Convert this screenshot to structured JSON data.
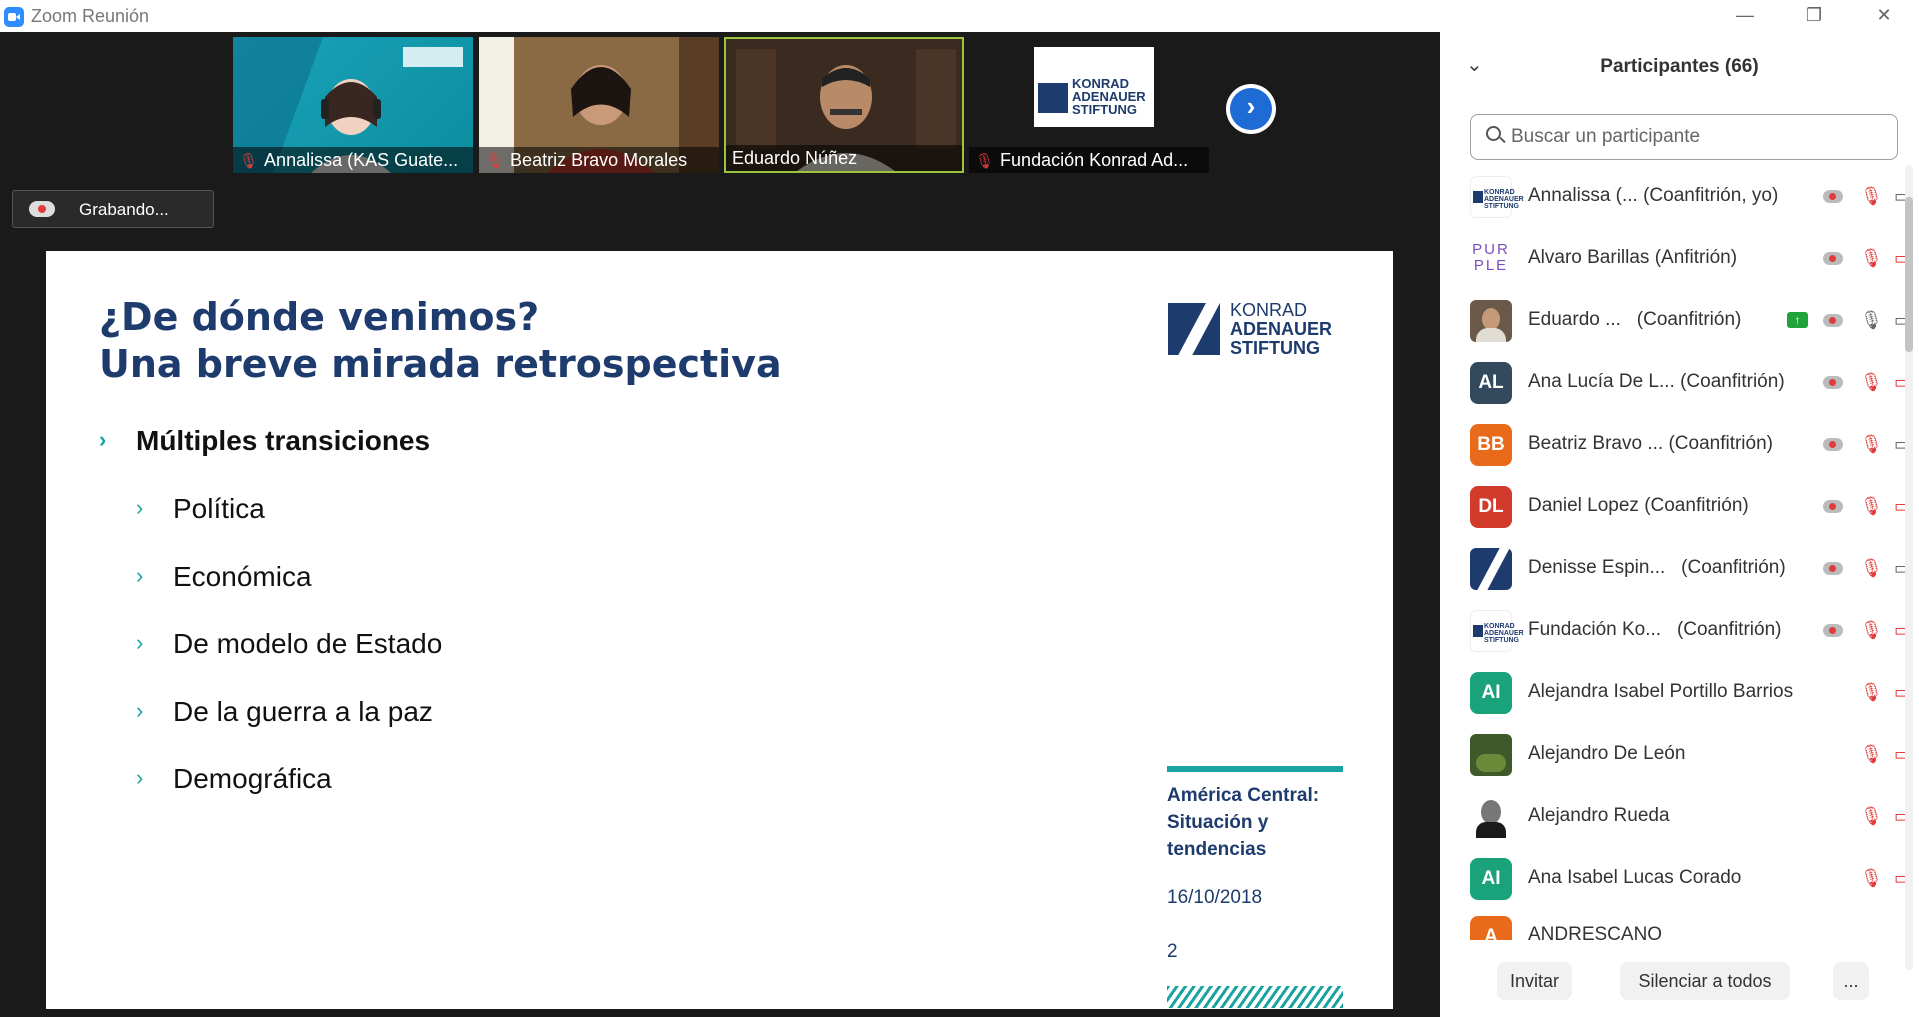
{
  "window": {
    "title": "Zoom Reunión",
    "minimize": "—",
    "restore": "❐",
    "close": "✕"
  },
  "recording": {
    "label": "Grabando..."
  },
  "thumbnails": [
    {
      "name": "Annalissa (KAS Guate...",
      "muted": true
    },
    {
      "name": "Beatriz Bravo Morales",
      "muted": true
    },
    {
      "name": "Eduardo Núñez",
      "muted": false
    },
    {
      "name": "Fundación Konrad Ad...",
      "muted": true
    }
  ],
  "thumb_logo_text": [
    "KONRAD",
    "ADENAUER",
    "STIFTUNG"
  ],
  "next_icon": "›",
  "slide": {
    "title_line1": "¿De dónde venimos?",
    "title_line2": "Una breve mirada retrospectiva",
    "bullet_main": "Múltiples transiciones",
    "bullets": [
      "Política",
      "Económica",
      "De modelo de Estado",
      "De la guerra a la paz",
      "Demográfica"
    ],
    "logo": [
      "KONRAD",
      "ADENAUER",
      "STIFTUNG"
    ],
    "side_title": "América Central: Situación y tendencias",
    "date": "16/10/2018",
    "page": "2",
    "chevron": "›"
  },
  "panel": {
    "title": "Participantes (66)",
    "collapse_icon": "⌄",
    "search_placeholder": "Buscar un participante",
    "participants": [
      {
        "name": "Annalissa (...",
        "role": "(Coanfitrión, yo)",
        "avatar": "logo"
      },
      {
        "name": "Alvaro Barillas (Anfitrión)",
        "role": "",
        "avatar": "purple"
      },
      {
        "name": "Eduardo ...",
        "role": "(Coanfitrión)",
        "avatar": "photo"
      },
      {
        "name": "Ana Lucía De L...",
        "role": "(Coanfitrión)",
        "avatar": "AL"
      },
      {
        "name": "Beatriz Bravo ...",
        "role": "(Coanfitrión)",
        "avatar": "BB"
      },
      {
        "name": "Daniel Lopez (Coanfitrión)",
        "role": "",
        "avatar": "DL"
      },
      {
        "name": "Denisse Espin...",
        "role": "(Coanfitrión)",
        "avatar": "kasmark"
      },
      {
        "name": "Fundación Ko...",
        "role": "(Coanfitrión)",
        "avatar": "logo"
      },
      {
        "name": "Alejandra Isabel Portillo Barrios",
        "role": "",
        "avatar": "AI"
      },
      {
        "name": "Alejandro De León",
        "role": "",
        "avatar": "photo"
      },
      {
        "name": "Alejandro Rueda",
        "role": "",
        "avatar": "photo"
      },
      {
        "name": "Ana Isabel Lucas Corado",
        "role": "",
        "avatar": "AI"
      },
      {
        "name": "ANDRESCANO",
        "role": "",
        "avatar": "A"
      }
    ],
    "purple_logo": "PUR PLE",
    "share_icon": "↑",
    "mic_icon": "🎙",
    "cam_icon": "▭",
    "buttons": {
      "invite": "Invitar",
      "mute_all": "Silenciar a todos",
      "more": "..."
    }
  },
  "colors": {
    "accent": "#2D8CFF",
    "brand": "#1e3b6e",
    "teal": "#1aa3a3",
    "muted": "#e23b3b"
  }
}
